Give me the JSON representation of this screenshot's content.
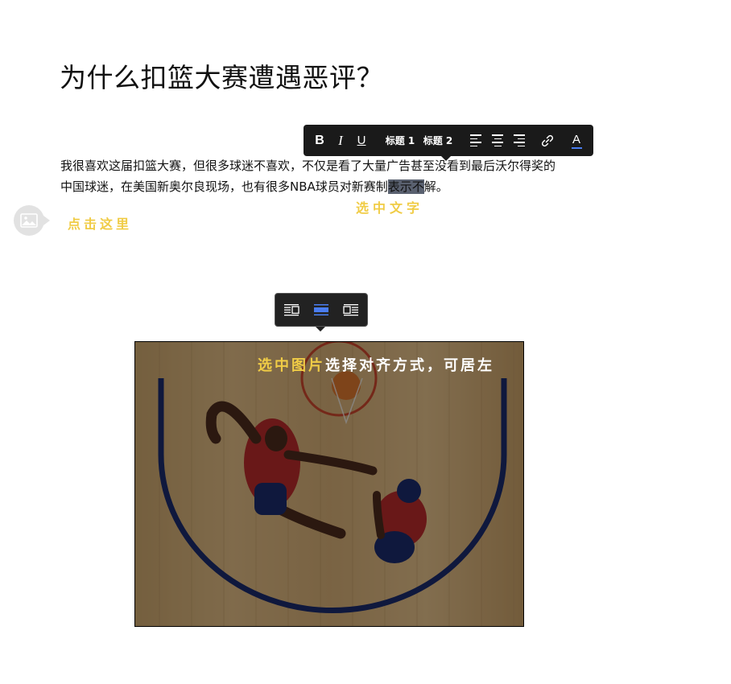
{
  "article": {
    "title": "为什么扣篮大赛遭遇恶评？",
    "paragraph_line1": "我很喜欢这届扣篮大赛，但很多球迷不喜欢，不仅是看了大量广告甚至没看到最后沃尔得奖的",
    "paragraph_line2_a": "中国球迷，在美国新奥尔良现场，也有很多NBA球员对新赛制",
    "paragraph_line2_sel": "表示不",
    "paragraph_line2_b": "解。"
  },
  "toolbar": {
    "bold": "B",
    "italic": "I",
    "underline": "U",
    "heading1": "标题 1",
    "heading2": "标题 2",
    "font_color": "A",
    "icons": [
      "align-left-icon",
      "align-center-icon",
      "align-right-icon",
      "link-icon",
      "font-color-icon"
    ],
    "accent_color": "#4a7df0"
  },
  "hints": {
    "click_here": "点击这里",
    "select_text": "选中文字",
    "select_image": "选中图片",
    "align_choice": "选择对齐方式，可居左"
  },
  "image_toolbar": {
    "icons": [
      "image-align-left-icon",
      "image-align-center-icon",
      "image-align-right-icon"
    ],
    "active": "center"
  },
  "colors": {
    "hint_yellow": "#f0cc46",
    "toolbar_bg": "#1a1a1a",
    "selection": "#5a6170"
  }
}
